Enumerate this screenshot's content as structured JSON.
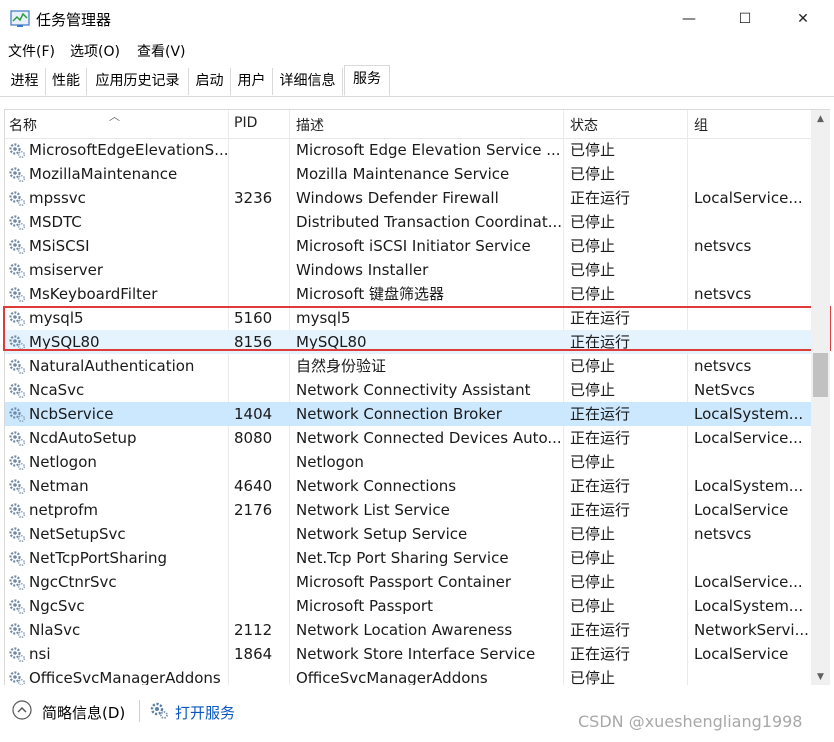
{
  "window": {
    "title": "任务管理器",
    "minimize_glyph": "—",
    "maximize_glyph": "☐",
    "close_glyph": "✕"
  },
  "menu": [
    "文件(F)",
    "选项(O)",
    "查看(V)"
  ],
  "tabs": [
    "进程",
    "性能",
    "应用历史记录",
    "启动",
    "用户",
    "详细信息",
    "服务"
  ],
  "active_tab": "服务",
  "columns": {
    "name": "名称",
    "pid": "PID",
    "desc": "描述",
    "status": "状态",
    "group": "组"
  },
  "rows": [
    {
      "name": "MicrosoftEdgeElevationS...",
      "pid": "",
      "desc": "Microsoft Edge Elevation Service ...",
      "status": "已停止",
      "group": ""
    },
    {
      "name": "MozillaMaintenance",
      "pid": "",
      "desc": "Mozilla Maintenance Service",
      "status": "已停止",
      "group": ""
    },
    {
      "name": "mpssvc",
      "pid": "3236",
      "desc": "Windows Defender Firewall",
      "status": "正在运行",
      "group": "LocalService..."
    },
    {
      "name": "MSDTC",
      "pid": "",
      "desc": "Distributed Transaction Coordinat...",
      "status": "已停止",
      "group": ""
    },
    {
      "name": "MSiSCSI",
      "pid": "",
      "desc": "Microsoft iSCSI Initiator Service",
      "status": "已停止",
      "group": "netsvcs"
    },
    {
      "name": "msiserver",
      "pid": "",
      "desc": "Windows Installer",
      "status": "已停止",
      "group": ""
    },
    {
      "name": "MsKeyboardFilter",
      "pid": "",
      "desc": "Microsoft 键盘筛选器",
      "status": "已停止",
      "group": "netsvcs"
    },
    {
      "name": "mysql5",
      "pid": "5160",
      "desc": "mysql5",
      "status": "正在运行",
      "group": ""
    },
    {
      "name": "MySQL80",
      "pid": "8156",
      "desc": "MySQL80",
      "status": "正在运行",
      "group": "",
      "highlighted": true
    },
    {
      "name": "NaturalAuthentication",
      "pid": "",
      "desc": "自然身份验证",
      "status": "已停止",
      "group": "netsvcs"
    },
    {
      "name": "NcaSvc",
      "pid": "",
      "desc": "Network Connectivity Assistant",
      "status": "已停止",
      "group": "NetSvcs"
    },
    {
      "name": "NcbService",
      "pid": "1404",
      "desc": "Network Connection Broker",
      "status": "正在运行",
      "group": "LocalSystem...",
      "selected": true
    },
    {
      "name": "NcdAutoSetup",
      "pid": "8080",
      "desc": "Network Connected Devices Auto...",
      "status": "正在运行",
      "group": "LocalService..."
    },
    {
      "name": "Netlogon",
      "pid": "",
      "desc": "Netlogon",
      "status": "已停止",
      "group": ""
    },
    {
      "name": "Netman",
      "pid": "4640",
      "desc": "Network Connections",
      "status": "正在运行",
      "group": "LocalSystem..."
    },
    {
      "name": "netprofm",
      "pid": "2176",
      "desc": "Network List Service",
      "status": "正在运行",
      "group": "LocalService"
    },
    {
      "name": "NetSetupSvc",
      "pid": "",
      "desc": "Network Setup Service",
      "status": "已停止",
      "group": "netsvcs"
    },
    {
      "name": "NetTcpPortSharing",
      "pid": "",
      "desc": "Net.Tcp Port Sharing Service",
      "status": "已停止",
      "group": ""
    },
    {
      "name": "NgcCtnrSvc",
      "pid": "",
      "desc": "Microsoft Passport Container",
      "status": "已停止",
      "group": "LocalService..."
    },
    {
      "name": "NgcSvc",
      "pid": "",
      "desc": "Microsoft Passport",
      "status": "已停止",
      "group": "LocalSystem..."
    },
    {
      "name": "NlaSvc",
      "pid": "2112",
      "desc": "Network Location Awareness",
      "status": "正在运行",
      "group": "NetworkServi..."
    },
    {
      "name": "nsi",
      "pid": "1864",
      "desc": "Network Store Interface Service",
      "status": "正在运行",
      "group": "LocalService"
    },
    {
      "name": "OfficeSvcManagerAddons",
      "pid": "",
      "desc": "OfficeSvcManagerAddons",
      "status": "已停止",
      "group": ""
    }
  ],
  "footer": {
    "fewer_details": "简略信息(D)",
    "open_services": "打开服务"
  },
  "watermark": "CSDN @xueshengliang1998",
  "colors": {
    "selected_row": "#cce8ff",
    "highlight_row": "#e5f3ff",
    "annotation_box": "#e03b3b",
    "link": "#0a57c2"
  }
}
